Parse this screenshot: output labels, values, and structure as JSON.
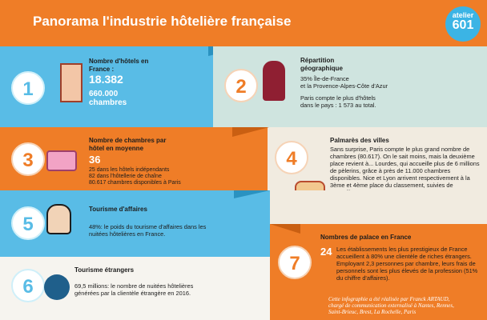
{
  "header": {
    "title": "Panorama l'industrie hôtelière française",
    "logo_top": "atelier",
    "logo_num": "601"
  },
  "items": [
    {
      "num": "1",
      "title": "Nombre d'hôtels en France :",
      "value1": "18.382",
      "value2": "660.000",
      "value3": "chambres"
    },
    {
      "num": "2",
      "title": "Répartition géographique",
      "line1": "35% Île-de-France",
      "line2": "et la Provence-Alpes-Côte d'Azur",
      "line3": "Paris compte le plus d'hôtels dans le pays : 1 573 au total."
    },
    {
      "num": "3",
      "title": "Nombre de chambres par hôtel en moyenne",
      "value": "36",
      "detail1": "25 dans les hôtels indépendants",
      "detail2": "82 dans l'hôtellerie de chaîne",
      "detail3": "80.617 chambres disponibles à Paris"
    },
    {
      "num": "4",
      "title": "Palmarès des villes",
      "text": "Sans surprise, Paris compte le plus grand nombre de chambres (80.617). On le sait moins, mais la deuxième place revient à... Lourdes, qui accueille plus de 6 millions de pèlerins, grâce à près de 11.000 chambres disponibles. Nice et Lyon arrivent respectivement à la 3ème et 4ème place du classement, suivies de Marseille."
    },
    {
      "num": "5",
      "title": "Tourisme d'affaires",
      "text": "48%: le poids du tourisme d'affaires dans les nuitées hôtelières en France."
    },
    {
      "num": "6",
      "title": "Tourisme étrangers",
      "text": "69,5 millions: le nombre de nuitées hôtelières générées par la clientèle étrangère en 2016."
    },
    {
      "num": "7",
      "title": "Nombres de palace en France",
      "value": "24",
      "text": "Les établissements les plus prestigieux de France accueillent à 80% une clientèle de riches étrangers. Employant 2,3 personnes par chambre, leurs frais de personnels sont les plus élevés de la profession (51% du chiffre d'affaires)."
    }
  ],
  "credit": "Cette infographie a été réalisée par Franck ARTAUD, chargé de communication externalisé à Nantes, Rennes, Saint-Brieuc, Brest, La Rochelle, Paris",
  "colors": {
    "orange": "#ef7d27",
    "blue": "#59bce6",
    "mint": "#cfe4df",
    "beige": "#f1ebe0"
  },
  "icons": [
    "hotel-icon",
    "bellboy-icon",
    "bed-icon",
    "house-icon",
    "businessman-icon",
    "globe-icon"
  ]
}
